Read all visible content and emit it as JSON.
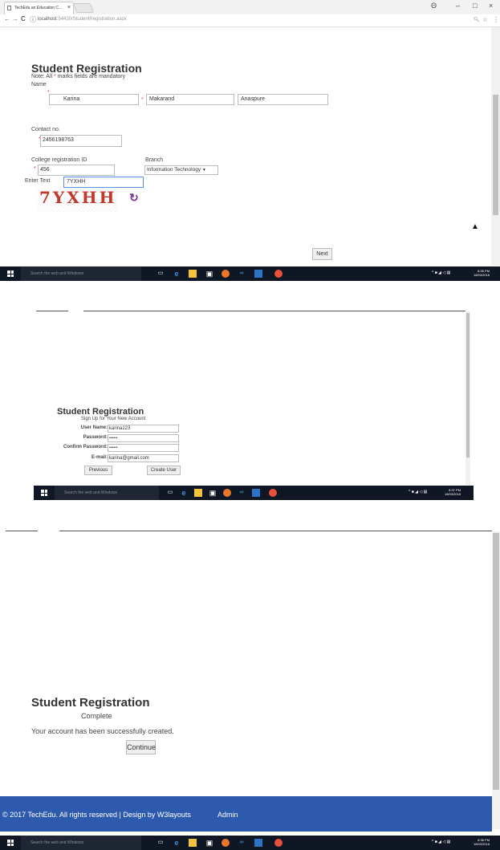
{
  "browser": {
    "tab_title": "TechEdu an Education C...",
    "tab_close": "×",
    "url_host": "localhost",
    "url_rest": ":54430/StudentRegistration.aspx",
    "back": "←",
    "forward": "→",
    "reload": "C",
    "info": "ⓘ",
    "account": "Θ",
    "minimize": "–",
    "maximize": "□",
    "close": "×",
    "zoom": "🔍︎",
    "star": "☆",
    "menu": "⋮"
  },
  "step1": {
    "title": "Student Registration",
    "note_prefix": "Note: All",
    "note_star": "*",
    "note_suffix": "marks fields are mandatory",
    "name_label": "Name",
    "first_name": "Karina",
    "middle_name": "Makarand",
    "last_name": "Anaspure",
    "contact_label": "Contact no.",
    "contact_value": "2456198763",
    "college_id_label": "College registration ID",
    "college_id_value": "456",
    "branch_label": "Branch",
    "branch_value": "Information Technology",
    "captcha_label": "Enter Text",
    "captcha_value": "7YXHH",
    "captcha_image_text": "7YXHH",
    "refresh_icon": "↻",
    "next_button": "Next",
    "scroll_top_icon": "▲"
  },
  "step2": {
    "title": "Student Registration",
    "subtitle": "Sign Up for Your New Account",
    "username_label": "User Name:",
    "username_value": "karina123",
    "password_label": "Password:",
    "password_value": "••••••",
    "confirm_label": "Confirm Password:",
    "confirm_value": "••••••",
    "email_label": "E-mail:",
    "email_value": "karina@gmail.com",
    "previous_button": "Previous",
    "create_button": "Create User"
  },
  "step3": {
    "title": "Student Registration",
    "subtitle": "Complete",
    "message": "Your account has been successfully created.",
    "continue_button": "Continue",
    "footer_text": "© 2017 TechEdu. All rights reserved | Design by W3layouts",
    "footer_admin": "Admin"
  },
  "taskbar": {
    "search_placeholder": "Search the web and Windows",
    "time1": "8:35 PM",
    "time2": "8:37 PM",
    "time3": "8:38 PM",
    "date": "18/03/2018",
    "tray": "^ ■ ◢ ◁ ▤"
  },
  "colors": {
    "accent": "#2d5aad",
    "captcha_red": "#c0392b",
    "captcha_purple": "#7a2c8c",
    "taskbar": "#0f1724"
  }
}
